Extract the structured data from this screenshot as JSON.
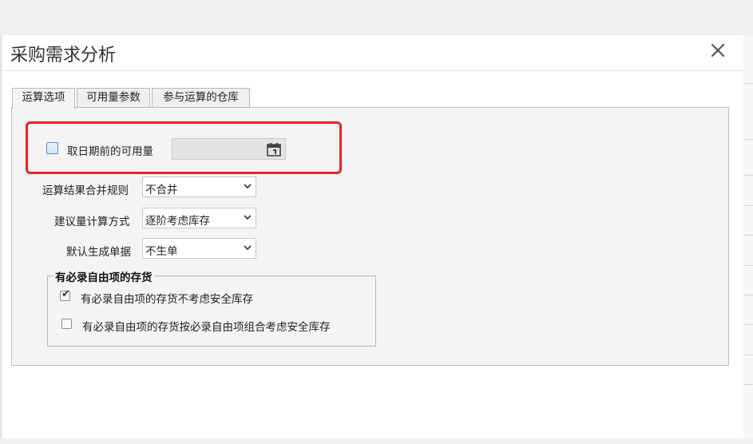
{
  "dialog": {
    "title": "采购需求分析",
    "close_icon": "close-icon"
  },
  "tabs": [
    {
      "label": "运算选项",
      "active": true
    },
    {
      "label": "可用量参数",
      "active": false
    },
    {
      "label": "参与运算的仓库",
      "active": false
    }
  ],
  "options": {
    "available_before_date": {
      "label": "取日期前的可用量",
      "checked": false,
      "date_value": "",
      "calendar_icon": "calendar-icon"
    },
    "merge_rule": {
      "label": "运算结果合并规则",
      "value": "不合并"
    },
    "calc_method": {
      "label": "建议量计算方式",
      "value": "逐阶考虑库存"
    },
    "default_doc": {
      "label": "默认生成单据",
      "value": "不生单"
    }
  },
  "free_item_group": {
    "legend": "有必录自由项的存货",
    "items": [
      {
        "label": "有必录自由项的存货不考虑安全库存",
        "checked": true
      },
      {
        "label": "有必录自由项的存货按必录自由项组合考虑安全库存",
        "checked": false
      }
    ]
  },
  "colors": {
    "highlight": "#e8231d",
    "checkbox_accent": "#5b8fd6"
  }
}
